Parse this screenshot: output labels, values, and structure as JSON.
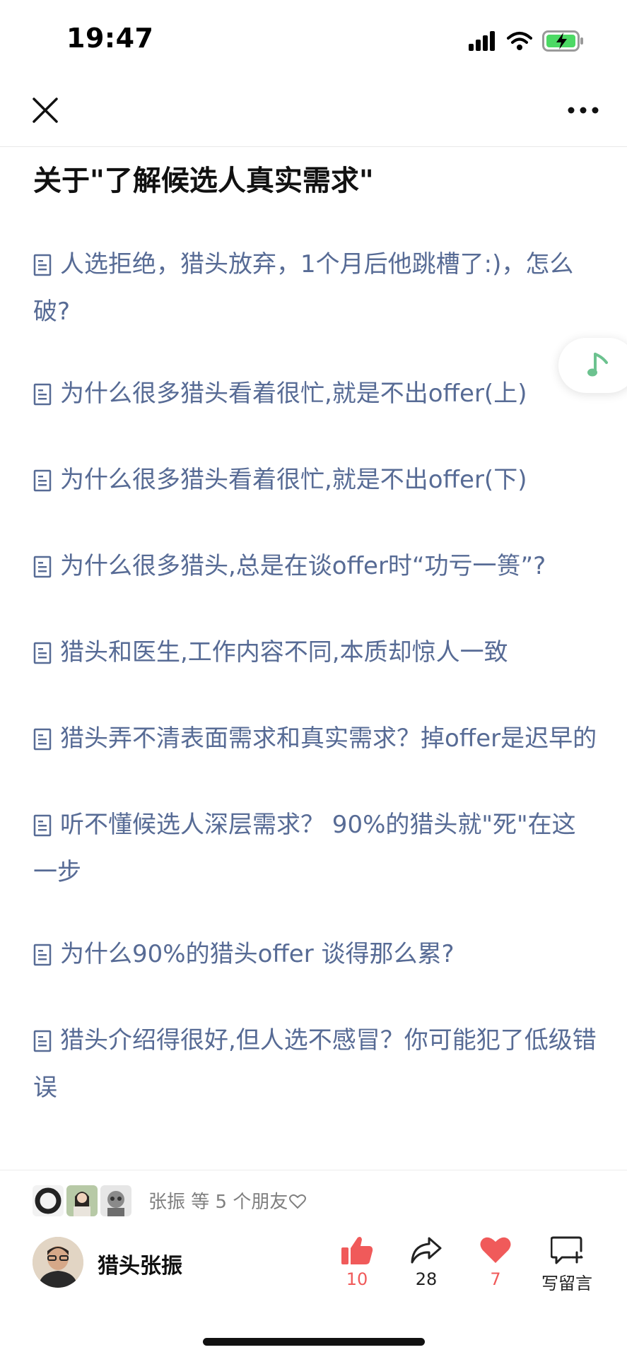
{
  "status_bar": {
    "time": "19:47"
  },
  "article": {
    "title": "关于\"了解候选人真实需求\"",
    "links": [
      "人选拒绝，猎头放弃，1个月后他跳槽了:)，怎么破?",
      "为什么很多猎头看着很忙,就是不出offer(上)",
      "为什么很多猎头看着很忙,就是不出offer(下)",
      "为什么很多猎头,总是在谈offer时“功亏一篑”?",
      "猎头和医生,工作内容不同,本质却惊人一致",
      "猎头弄不清表面需求和真实需求？掉offer是迟早的",
      "听不懂候选人深层需求？ 90%的猎头就\"死\"在这一步",
      "为什么90%的猎头offer 谈得那么累?",
      "猎头介绍得很好,但人选不感冒？你可能犯了低级错误"
    ]
  },
  "footer": {
    "friends_text": "张振 等 5 个朋友",
    "author_name": "猎头张振",
    "actions": {
      "like_count": "10",
      "share_count": "28",
      "heart_count": "7",
      "comment_label": "写留言"
    }
  },
  "colors": {
    "link": "#576b95",
    "accent_red": "#f05a5a",
    "music_green": "#6cc28f",
    "battery_green": "#4cd964"
  }
}
